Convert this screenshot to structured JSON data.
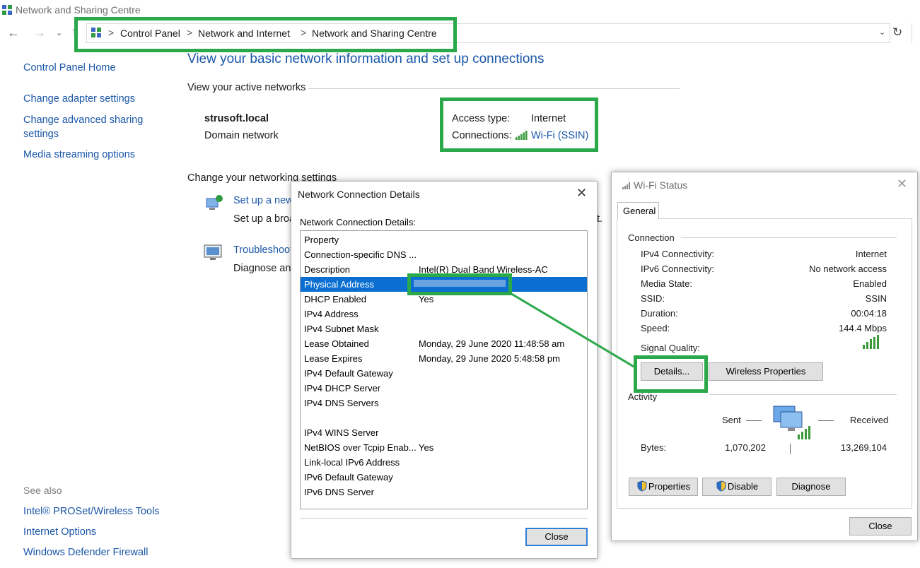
{
  "window": {
    "title": "Network and Sharing Centre"
  },
  "breadcrumb": {
    "items": [
      "Control Panel",
      "Network and Internet",
      "Network and Sharing Centre"
    ],
    "separator": ">"
  },
  "sidebar": {
    "home": "Control Panel Home",
    "links": [
      "Change adapter settings",
      "Change advanced sharing",
      "settings",
      "Media streaming options"
    ],
    "see_also_heading": "See also",
    "see_also": [
      "Intel® PROSet/Wireless Tools",
      "Internet Options",
      "Windows Defender Firewall"
    ]
  },
  "main": {
    "heading": "View your basic network information and set up connections",
    "active_networks_label": "View your active networks",
    "network_name": "strusoft.local",
    "network_type": "Domain network",
    "access_type_label": "Access type:",
    "access_type_value": "Internet",
    "connections_label": "Connections:",
    "connections_value": "Wi-Fi (SSIN)",
    "change_settings_label": "Change your networking settings",
    "setup_link": "Set up a new",
    "setup_desc": "Set up a broa",
    "setup_desc_tail": "t.",
    "troubleshoot_link": "Troubleshoot",
    "troubleshoot_desc": "Diagnose and"
  },
  "details_dialog": {
    "title": "Network Connection Details",
    "list_label": "Network Connection Details:",
    "rows": [
      {
        "property": "Property",
        "value": ""
      },
      {
        "property": "Connection-specific DNS ...",
        "value": ""
      },
      {
        "property": "Description",
        "value": "Intel(R) Dual Band Wireless-AC"
      },
      {
        "property": "Physical Address",
        "value": ""
      },
      {
        "property": "DHCP Enabled",
        "value": "Yes"
      },
      {
        "property": "IPv4 Address",
        "value": ""
      },
      {
        "property": "IPv4 Subnet Mask",
        "value": ""
      },
      {
        "property": "Lease Obtained",
        "value": "Monday, 29 June 2020 11:48:58 am"
      },
      {
        "property": "Lease Expires",
        "value": "Monday, 29 June 2020 5:48:58 pm"
      },
      {
        "property": "IPv4 Default Gateway",
        "value": ""
      },
      {
        "property": "IPv4 DHCP Server",
        "value": ""
      },
      {
        "property": "IPv4 DNS Servers",
        "value": ""
      },
      {
        "property": "",
        "value": ""
      },
      {
        "property": "IPv4 WINS Server",
        "value": ""
      },
      {
        "property": "NetBIOS over Tcpip Enab...",
        "value": "Yes"
      },
      {
        "property": "Link-local IPv6 Address",
        "value": ""
      },
      {
        "property": "IPv6 Default Gateway",
        "value": ""
      },
      {
        "property": "IPv6 DNS Server",
        "value": ""
      }
    ],
    "selected_row": 3,
    "close_button": "Close"
  },
  "wifi_dialog": {
    "title": "Wi-Fi Status",
    "tab": "General",
    "connection_group": "Connection",
    "fields": [
      {
        "label": "IPv4 Connectivity:",
        "value": "Internet"
      },
      {
        "label": "IPv6 Connectivity:",
        "value": "No network access"
      },
      {
        "label": "Media State:",
        "value": "Enabled"
      },
      {
        "label": "SSID:",
        "value": "SSIN"
      },
      {
        "label": "Duration:",
        "value": "00:04:18"
      },
      {
        "label": "Speed:",
        "value": "144.4 Mbps"
      }
    ],
    "signal_label": "Signal Quality:",
    "details_button": "Details...",
    "wireless_properties_button": "Wireless Properties",
    "activity_group": "Activity",
    "sent_label": "Sent",
    "received_label": "Received",
    "bytes_label": "Bytes:",
    "bytes_sent": "1,070,202",
    "bytes_received": "13,269,104",
    "properties_button": "Properties",
    "disable_button": "Disable",
    "diagnose_button": "Diagnose",
    "close_button": "Close"
  },
  "colors": {
    "link": "#1a57a8",
    "highlight": "#2aa84a",
    "selection": "#0a6fd1"
  }
}
